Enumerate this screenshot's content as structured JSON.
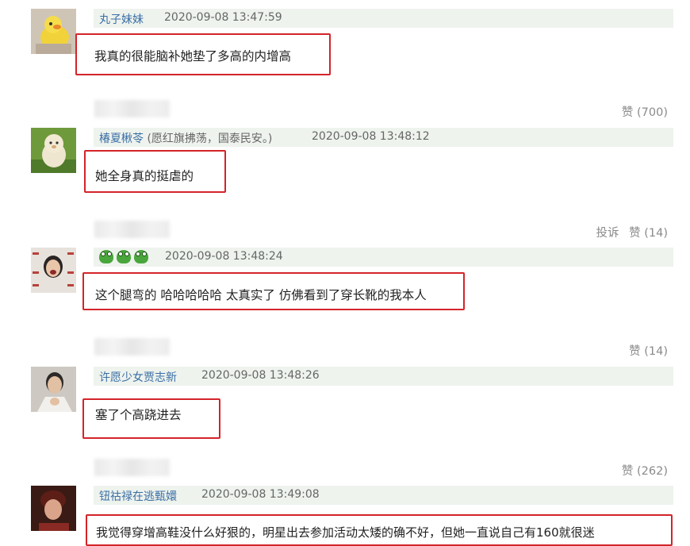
{
  "comments": [
    {
      "username": "丸子妹妹",
      "timestamp": "2020-09-08 13:47:59",
      "text": "我真的很能脑补她垫了多高的内增高",
      "actions": {
        "report": "",
        "like": "赞 (700)"
      }
    },
    {
      "username": "椿夏楸苓",
      "username_note": "(愿红旗拂荡，国泰民安。)",
      "timestamp": "2020-09-08 13:48:12",
      "text": "她全身真的挺虐的",
      "actions": {
        "report": "投诉",
        "like": "赞 (14)"
      }
    },
    {
      "username_emoji": "frog-emoji",
      "timestamp": "2020-09-08 13:48:24",
      "text": "这个腿弯的 哈哈哈哈哈 太真实了 仿佛看到了穿长靴的我本人",
      "actions": {
        "report": "",
        "like": "赞 (14)"
      }
    },
    {
      "username": "许愿少女贾志新",
      "timestamp": "2020-09-08 13:48:26",
      "text": "塞了个高跷进去",
      "actions": {
        "report": "",
        "like": "赞 (262)"
      }
    },
    {
      "username": "钮祜禄在逃甄嬛",
      "timestamp": "2020-09-08 13:49:08",
      "text": "我觉得穿增高鞋没什么好狠的，明星出去参加活动太矮的确不好，但她一直说自己有160就很迷"
    }
  ],
  "colors": {
    "highlight": "#d4242a",
    "username": "#3b6fa5",
    "meta_bg": "#eef3ee"
  }
}
